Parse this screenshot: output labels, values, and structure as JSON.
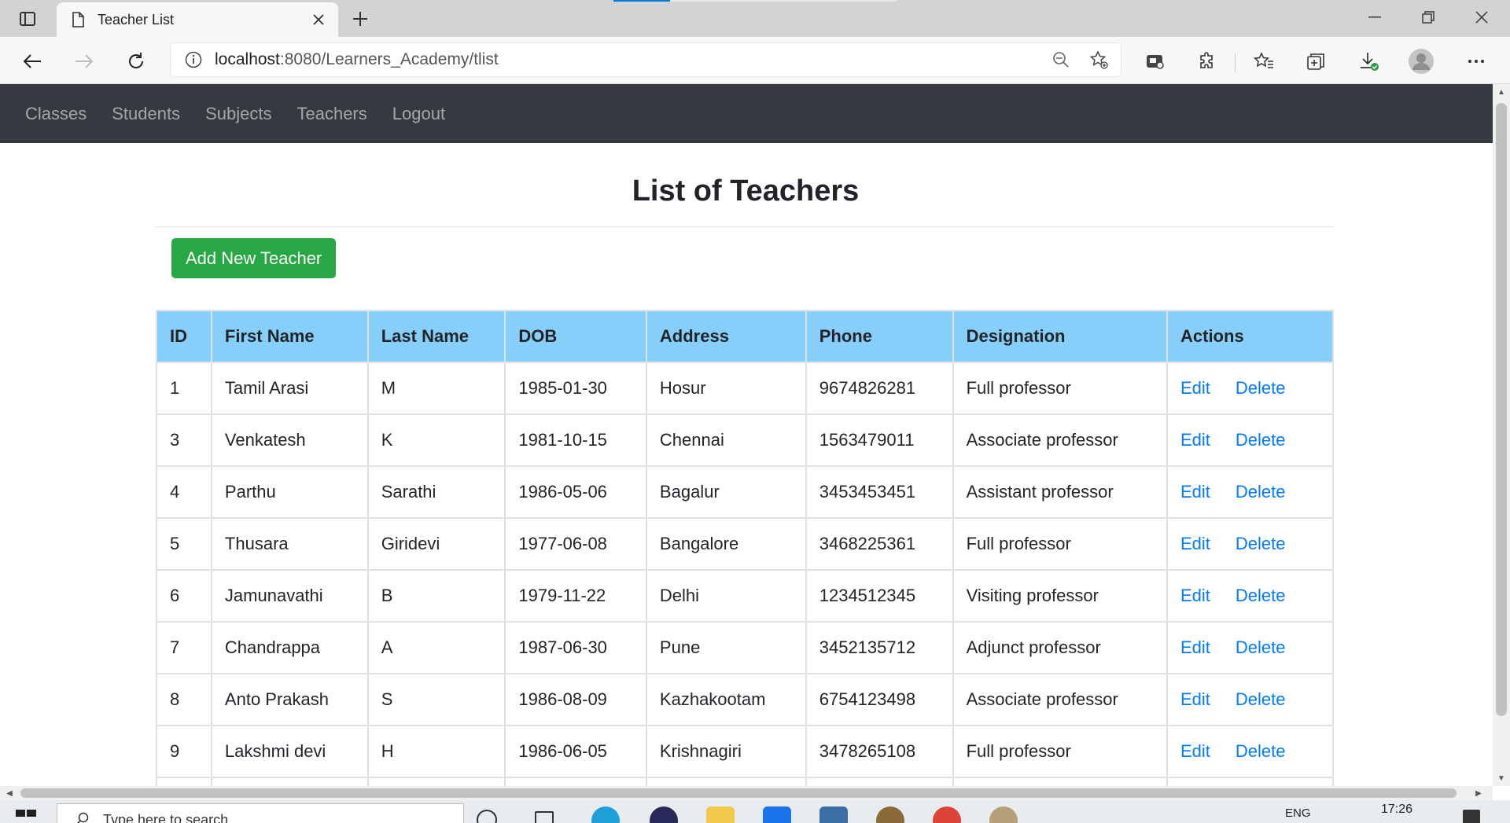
{
  "browser": {
    "tab_title": "Teacher List",
    "url_host": "localhost",
    "url_path": ":8080/Learners_Academy/tlist"
  },
  "nav": {
    "items": [
      "Classes",
      "Students",
      "Subjects",
      "Teachers",
      "Logout"
    ]
  },
  "page": {
    "title": "List of Teachers",
    "add_button": "Add New Teacher"
  },
  "table": {
    "headers": [
      "ID",
      "First Name",
      "Last Name",
      "DOB",
      "Address",
      "Phone",
      "Designation",
      "Actions"
    ],
    "action_labels": {
      "edit": "Edit",
      "delete": "Delete"
    },
    "rows": [
      [
        "1",
        "Tamil Arasi",
        "M",
        "1985-01-30",
        "Hosur",
        "9674826281",
        "Full professor"
      ],
      [
        "3",
        "Venkatesh",
        "K",
        "1981-10-15",
        "Chennai",
        "1563479011",
        "Associate professor"
      ],
      [
        "4",
        "Parthu",
        "Sarathi",
        "1986-05-06",
        "Bagalur",
        "3453453451",
        "Assistant professor"
      ],
      [
        "5",
        "Thusara",
        "Giridevi",
        "1977-06-08",
        "Bangalore",
        "3468225361",
        "Full professor"
      ],
      [
        "6",
        "Jamunavathi",
        "B",
        "1979-11-22",
        "Delhi",
        "1234512345",
        "Visiting professor"
      ],
      [
        "7",
        "Chandrappa",
        "A",
        "1987-06-30",
        "Pune",
        "3452135712",
        "Adjunct professor"
      ],
      [
        "8",
        "Anto Prakash",
        "S",
        "1986-08-09",
        "Kazhakootam",
        "6754123498",
        "Associate professor"
      ],
      [
        "9",
        "Lakshmi devi",
        "H",
        "1986-06-05",
        "Krishnagiri",
        "3478265108",
        "Full professor"
      ],
      [
        "",
        "",
        "",
        "",
        "",
        "",
        ""
      ]
    ]
  },
  "taskbar": {
    "search_placeholder": "Type here to search",
    "clock_time": "17:26",
    "language": "ENG"
  },
  "colors": {
    "navbar_bg": "#343a40",
    "table_header_bg": "#87cefa",
    "add_button_bg": "#28a745",
    "link_color": "#007bff"
  }
}
